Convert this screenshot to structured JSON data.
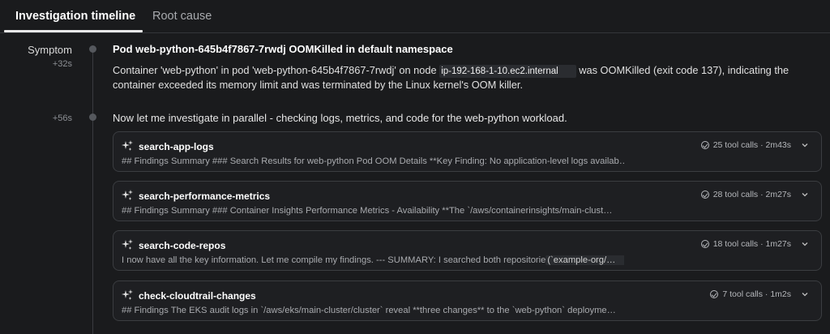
{
  "tabs": {
    "active": "Investigation timeline",
    "inactive": "Root cause"
  },
  "symptom": {
    "label": "Symptom",
    "time": "+32s",
    "title": "Pod web-python-645b4f7867-7rwdj OOMKilled in default namespace",
    "desc_before": "Container 'web-python' in pod 'web-python-645b4f7867-7rwdj' on node ",
    "node": "ip-192-168-1-10.ec2.internal",
    "desc_after": " was OOMKilled (exit code 137), indicating the container exceeded its memory limit and was terminated by the Linux kernel's OOM killer."
  },
  "step": {
    "time": "+56s",
    "message": "Now let me investigate in parallel - checking logs, metrics, and code for the web-python workload."
  },
  "cards": [
    {
      "name": "search-app-logs",
      "meta": "25 tool calls · 2m43s",
      "summary": "## Findings Summary ### Search Results for web-python Pod OOM Details **Key Finding: No application-level logs availab…"
    },
    {
      "name": "search-performance-metrics",
      "meta": "28 tool calls · 2m27s",
      "summary": "## Findings Summary ### Container Insights Performance Metrics - Availability **The `/aws/containerinsights/main-clust…"
    },
    {
      "name": "search-code-repos",
      "meta": "18 tool calls · 1m27s",
      "summary_before": "I now have all the key information. Let me compile my findings. --- SUMMARY: I searched both repositorie",
      "summary_chip": "(`example-org/…"
    },
    {
      "name": "check-cloudtrail-changes",
      "meta": "7 tool calls · 1m2s",
      "summary": "## Findings The EKS audit logs in `/aws/eks/main-cluster/cluster` reveal **three changes** to the `web-python` deployme…"
    }
  ]
}
